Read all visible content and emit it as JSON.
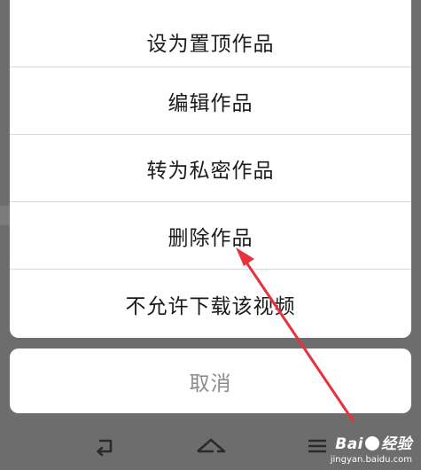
{
  "action_sheet": {
    "items": [
      {
        "label": "设为置顶作品"
      },
      {
        "label": "编辑作品"
      },
      {
        "label": "转为私密作品"
      },
      {
        "label": "删除作品"
      },
      {
        "label": "不允许下载该视频"
      }
    ]
  },
  "cancel": {
    "label": "取消"
  },
  "nav": {
    "back_icon": "back-icon",
    "home_icon": "home-icon",
    "menu_icon": "menu-icon"
  },
  "annotation": {
    "color": "#e8313a"
  },
  "watermark": {
    "logo_prefix": "Bai",
    "logo_suffix": "经验",
    "url": "jingyan.baidu.com"
  },
  "colors": {
    "overlay": "#6d6d6d",
    "sheet": "#ffffff",
    "cancel_text": "#8b8b8b"
  }
}
